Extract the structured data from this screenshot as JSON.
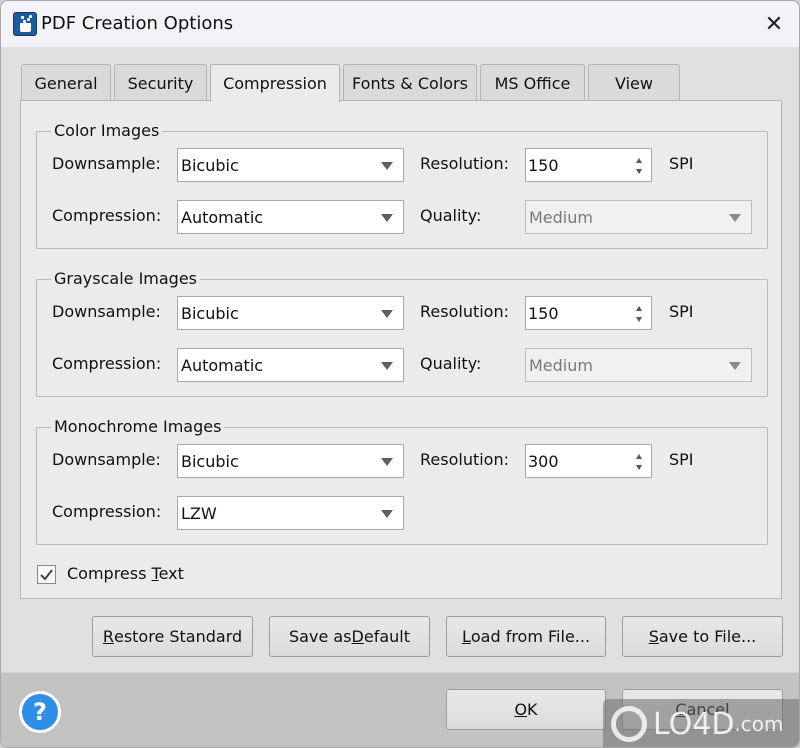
{
  "window": {
    "title": "PDF Creation Options",
    "close_label": "✕"
  },
  "tabs": [
    {
      "label": "General"
    },
    {
      "label": "Security"
    },
    {
      "label": "Compression",
      "active": true
    },
    {
      "label": "Fonts & Colors"
    },
    {
      "label": "MS Office"
    },
    {
      "label": "View"
    }
  ],
  "labels": {
    "downsample": "Downsample:",
    "compression": "Compression:",
    "resolution": "Resolution:",
    "quality": "Quality:",
    "unit": "SPI"
  },
  "color_images": {
    "legend": "Color Images",
    "downsample": "Bicubic",
    "compression": "Automatic",
    "resolution": "150",
    "quality": "Medium"
  },
  "grayscale_images": {
    "legend": "Grayscale Images",
    "downsample": "Bicubic",
    "compression": "Automatic",
    "resolution": "150",
    "quality": "Medium"
  },
  "monochrome_images": {
    "legend": "Monochrome Images",
    "downsample": "Bicubic",
    "compression": "LZW",
    "resolution": "300"
  },
  "compress_text": {
    "label_pre": "Compress ",
    "label_mnemonic": "T",
    "label_post": "ext",
    "checked": true
  },
  "buttons": {
    "restore": {
      "mn": "R",
      "rest": "estore Standard"
    },
    "save_default": {
      "pre": "Save as ",
      "mn": "D",
      "rest": "efault"
    },
    "load_file": {
      "mn": "L",
      "rest": "oad from File..."
    },
    "save_file": {
      "mn": "S",
      "rest": "ave to File..."
    },
    "ok": {
      "mn": "O",
      "rest": "K"
    },
    "cancel": {
      "mn": "C",
      "rest": "ancel"
    }
  },
  "help_label": "?",
  "watermark": {
    "text": "LO4D",
    "suffix": ".com"
  },
  "colors": {
    "help_blue": "#2f8fe6",
    "app_icon_blue": "#1e5b9c"
  }
}
